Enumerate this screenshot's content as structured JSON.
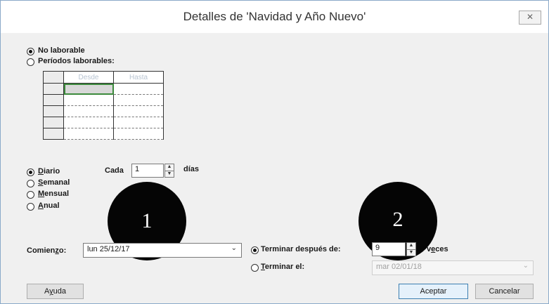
{
  "dialog": {
    "title": "Detalles de 'Navidad y Año Nuevo'",
    "close_icon": "close-icon"
  },
  "working_time": {
    "no_laborable": "No laborable",
    "periodos_laborables": "Períodos laborables:",
    "grid_headers": [
      "Desde",
      "Hasta"
    ]
  },
  "recurrence": {
    "diario": "Diario",
    "semanal": "Semanal",
    "mensual": "Mensual",
    "anual": "Anual",
    "cada_label": "Cada",
    "cada_value": "1",
    "dias_label": "días"
  },
  "markers": {
    "one": "1",
    "two": "2"
  },
  "range": {
    "comienzo_label": "Comienzo:",
    "comienzo_value": "lun 25/12/17",
    "terminar_despues_label": "Terminar después de:",
    "veces_value": "9",
    "veces_label": "veces",
    "terminar_el_label": "Terminar el:",
    "terminar_el_value": "mar 02/01/18"
  },
  "buttons": {
    "ayuda": "Ayuda",
    "aceptar": "Aceptar",
    "cancelar": "Cancelar"
  }
}
